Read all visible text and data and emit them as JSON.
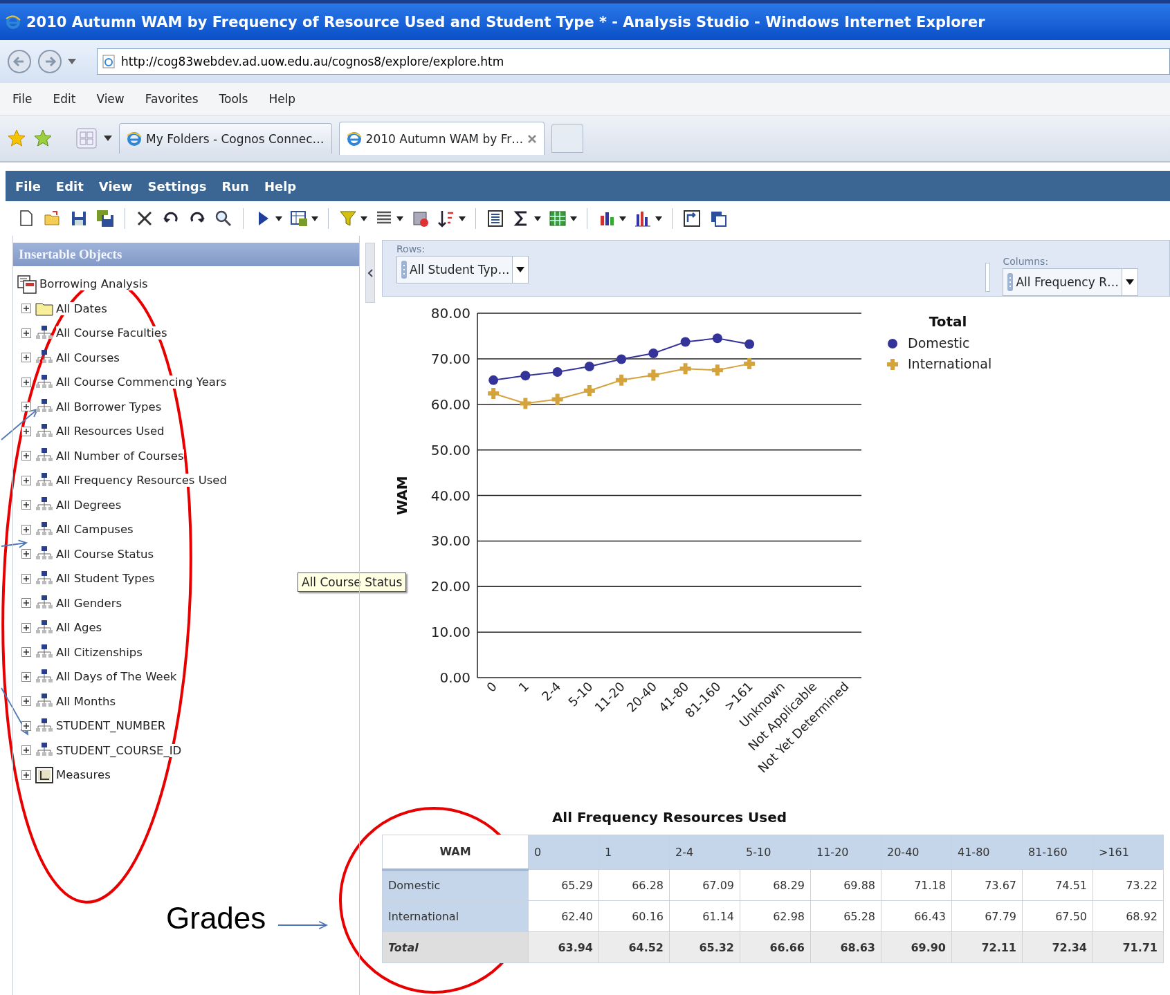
{
  "browser": {
    "title": "2010 Autumn WAM by Frequency of Resource Used and Student Type * - Analysis Studio - Windows Internet Explorer",
    "address": "http://cog83webdev.ad.uow.edu.au/cognos8/explore/explore.htm",
    "menu": [
      "File",
      "Edit",
      "View",
      "Favorites",
      "Tools",
      "Help"
    ],
    "tabs": [
      {
        "label": "My Folders - Cognos Connec…",
        "selected": false
      },
      {
        "label": "2010 Autumn WAM by Fr…",
        "selected": true
      }
    ]
  },
  "app_menu": [
    "File",
    "Edit",
    "View",
    "Settings",
    "Run",
    "Help"
  ],
  "insertable_objects": {
    "title": "Insertable Objects",
    "root": {
      "label": "Borrowing Analysis",
      "children": [
        {
          "label": "All Dates",
          "kind": "folder",
          "expanded": false
        },
        {
          "label": "All Course Faculties",
          "kind": "dimension",
          "expanded": false
        },
        {
          "label": "All Courses",
          "kind": "dimension",
          "expanded": false
        },
        {
          "label": "All Course Commencing Years",
          "kind": "dimension",
          "expanded": false
        },
        {
          "label": "All Borrower Types",
          "kind": "dimension",
          "expanded": false
        },
        {
          "label": "All Resources Used",
          "kind": "dimension",
          "expanded": false
        },
        {
          "label": "All Number of Courses",
          "kind": "dimension",
          "expanded": false
        },
        {
          "label": "All Frequency Resources Used",
          "kind": "dimension",
          "expanded": false
        },
        {
          "label": "All Degrees",
          "kind": "dimension",
          "expanded": false
        },
        {
          "label": "All Campuses",
          "kind": "dimension",
          "expanded": false
        },
        {
          "label": "All Course Status",
          "kind": "dimension",
          "expanded": false
        },
        {
          "label": "All Student Types",
          "kind": "dimension",
          "expanded": false
        },
        {
          "label": "All Genders",
          "kind": "dimension",
          "expanded": false
        },
        {
          "label": "All Ages",
          "kind": "dimension",
          "expanded": false
        },
        {
          "label": "All Citizenships",
          "kind": "dimension",
          "expanded": false
        },
        {
          "label": "All Days of The Week",
          "kind": "dimension",
          "expanded": false
        },
        {
          "label": "All Months",
          "kind": "dimension",
          "expanded": false
        },
        {
          "label": "STUDENT_NUMBER",
          "kind": "dimension",
          "expanded": false
        },
        {
          "label": "STUDENT_COURSE_ID",
          "kind": "dimension",
          "expanded": false
        },
        {
          "label": "Measures",
          "kind": "measures",
          "expanded": false
        }
      ]
    }
  },
  "tooltip": "All Course Status",
  "overview": {
    "rows_label": "Rows:",
    "rows_value": "All Student Typ…",
    "columns_label": "Columns:",
    "columns_value": "All Frequency R…"
  },
  "chart": {
    "chart_data": {
      "type": "line",
      "xlabel": "All Frequency Resources Used",
      "ylabel": "WAM",
      "grid": true,
      "legend": {
        "title": "Total"
      },
      "categories": [
        "0",
        "1",
        "2-4",
        "5-10",
        "11-20",
        "20-40",
        "41-80",
        "81-160",
        ">161",
        "Unknown",
        "Not Applicable",
        "Not Yet Determined"
      ],
      "series": [
        {
          "name": "Domestic",
          "color": "#33339a",
          "marker": "circle",
          "values": [
            65.3,
            66.3,
            67.1,
            68.3,
            69.9,
            71.2,
            73.7,
            74.5,
            73.2,
            null,
            null,
            null
          ]
        },
        {
          "name": "International",
          "color": "#d4a33c",
          "marker": "cross",
          "values": [
            62.4,
            60.2,
            61.1,
            63.0,
            65.3,
            66.4,
            67.8,
            67.5,
            68.9,
            null,
            null,
            null
          ]
        }
      ],
      "ylim": [
        0,
        80
      ],
      "yticks": [
        {
          "value": 0,
          "label": "0.00"
        },
        {
          "value": 10,
          "label": "10.00"
        },
        {
          "value": 20,
          "label": "20.00"
        },
        {
          "value": 30,
          "label": "30.00"
        },
        {
          "value": 40,
          "label": "40.00"
        },
        {
          "value": 50,
          "label": "50.00"
        },
        {
          "value": 60,
          "label": "60.00"
        },
        {
          "value": 70,
          "label": "70.00"
        },
        {
          "value": 80,
          "label": "80.00"
        }
      ]
    }
  },
  "crosstab": {
    "corner": "WAM",
    "columns": [
      "0",
      "1",
      "2-4",
      "5-10",
      "11-20",
      "20-40",
      "41-80",
      "81-160",
      ">161"
    ],
    "rows": [
      {
        "label": "Domestic",
        "kind": "member",
        "cells": [
          "65.29",
          "66.28",
          "67.09",
          "68.29",
          "69.88",
          "71.18",
          "73.67",
          "74.51",
          "73.22"
        ]
      },
      {
        "label": "International",
        "kind": "member",
        "cells": [
          "62.40",
          "60.16",
          "61.14",
          "62.98",
          "65.28",
          "66.43",
          "67.79",
          "67.50",
          "68.92"
        ]
      },
      {
        "label": "Total",
        "kind": "total",
        "cells": [
          "63.94",
          "64.52",
          "65.32",
          "66.66",
          "68.63",
          "69.90",
          "72.11",
          "72.34",
          "71.71"
        ]
      }
    ]
  },
  "annotation": {
    "label": "Grades"
  }
}
